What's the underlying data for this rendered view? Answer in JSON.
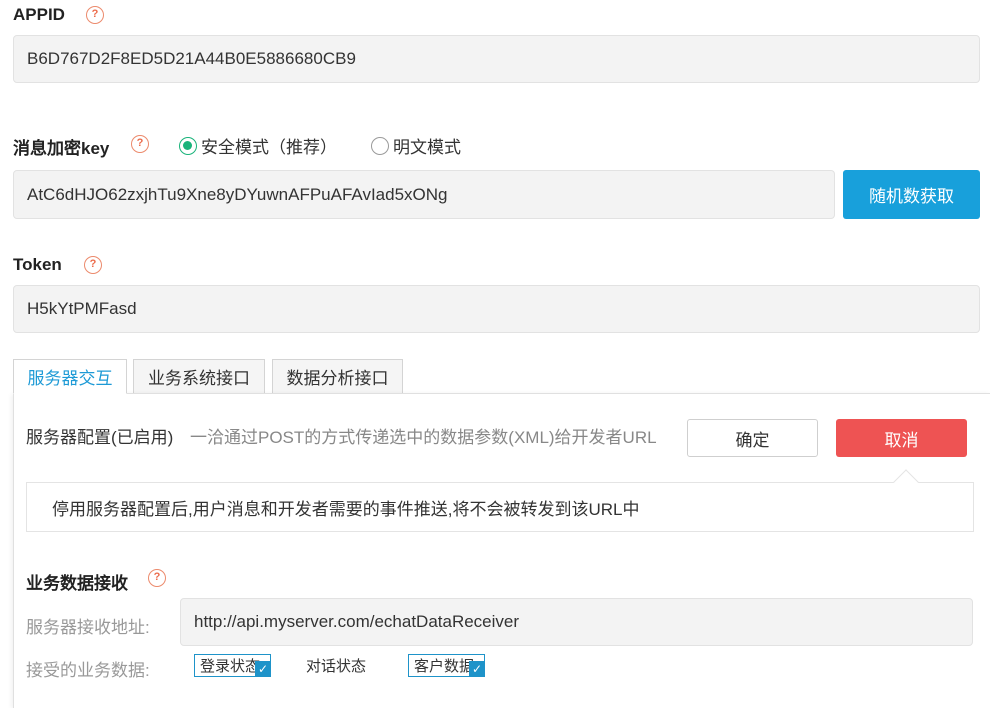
{
  "appid": {
    "label": "APPID",
    "value": "B6D767D2F8ED5D21A44B0E5886680CB9"
  },
  "encryption": {
    "label": "消息加密key",
    "mode_secure": "安全模式（推荐）",
    "mode_plain": "明文模式",
    "selected": "secure",
    "value": "AtC6dHJO62zxjhTu9Xne8yDYuwnAFPuAFAvIad5xONg",
    "random_button": "随机数获取"
  },
  "token": {
    "label": "Token",
    "value": "H5kYtPMFasd"
  },
  "help_icon": "?",
  "tabs": [
    {
      "label": "服务器交互",
      "active": true
    },
    {
      "label": "业务系统接口",
      "active": false
    },
    {
      "label": "数据分析接口",
      "active": false
    }
  ],
  "server_config": {
    "title": "服务器配置(已启用)",
    "description": "一洽通过POST的方式传递选中的数据参数(XML)给开发者URL",
    "confirm_button": "确定",
    "cancel_button": "取消",
    "notice": "停用服务器配置后,用户消息和开发者需要的事件推送,将不会被转发到该URL中"
  },
  "business_data": {
    "section_title": "业务数据接收",
    "address_label": "服务器接收地址:",
    "address_value": "http://api.myserver.com/echatDataReceiver",
    "accepted_label": "接受的业务数据:",
    "options": [
      {
        "label": "登录状态",
        "checked": true
      },
      {
        "label": "对话状态",
        "checked": false
      },
      {
        "label": "客户数据",
        "checked": true
      }
    ]
  },
  "colors": {
    "primary_blue": "#18a0db",
    "danger_red": "#ee5353",
    "radio_green": "#19b37a",
    "help_orange": "#ec6c4c"
  }
}
